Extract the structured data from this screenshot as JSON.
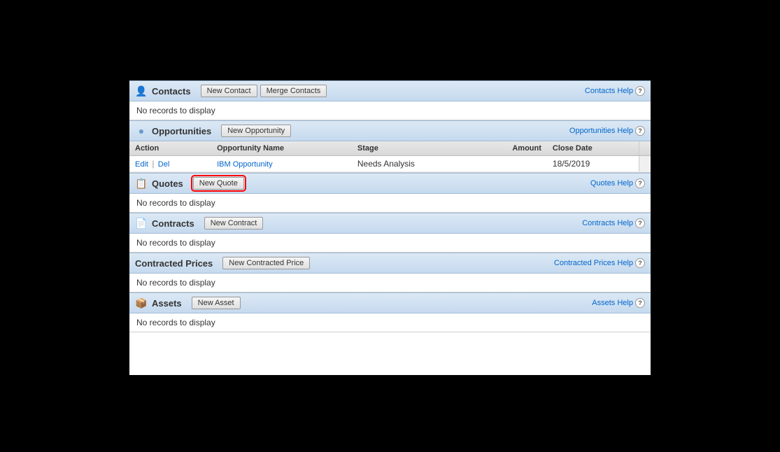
{
  "topBlackHeight": 115,
  "bottomBlackHeight": 110,
  "sections": {
    "contacts": {
      "title": "Contacts",
      "icon": "contacts-icon",
      "buttons": [
        {
          "label": "New Contact",
          "id": "new-contact",
          "highlighted": false
        },
        {
          "label": "Merge Contacts",
          "id": "merge-contacts",
          "highlighted": false
        }
      ],
      "helpText": "Contacts Help",
      "noRecords": "No records to display"
    },
    "opportunities": {
      "title": "Opportunities",
      "icon": "opportunities-icon",
      "buttons": [
        {
          "label": "New Opportunity",
          "id": "new-opportunity",
          "highlighted": false
        }
      ],
      "helpText": "Opportunities Help",
      "columns": [
        "Action",
        "Opportunity Name",
        "Stage",
        "Amount",
        "Close Date"
      ],
      "rows": [
        {
          "actions": [
            "Edit",
            "Del"
          ],
          "name": "IBM Opportunity",
          "stage": "Needs Analysis",
          "amount": "",
          "closeDate": "18/5/2019"
        }
      ]
    },
    "quotes": {
      "title": "Quotes",
      "icon": "quotes-icon",
      "buttons": [
        {
          "label": "New Quote",
          "id": "new-quote",
          "highlighted": true
        }
      ],
      "helpText": "Quotes Help",
      "noRecords": "No records to display"
    },
    "contracts": {
      "title": "Contracts",
      "icon": "contracts-icon",
      "buttons": [
        {
          "label": "New Contract",
          "id": "new-contract",
          "highlighted": false
        }
      ],
      "helpText": "Contracts Help",
      "noRecords": "No records to display"
    },
    "contractedPrices": {
      "title": "Contracted Prices",
      "icon": null,
      "buttons": [
        {
          "label": "New Contracted Price",
          "id": "new-contracted-price",
          "highlighted": false
        }
      ],
      "helpText": "Contracted Prices Help",
      "noRecords": "No records to display"
    },
    "assets": {
      "title": "Assets",
      "icon": "assets-icon",
      "buttons": [
        {
          "label": "New Asset",
          "id": "new-asset",
          "highlighted": false
        }
      ],
      "helpText": "Assets Help",
      "noRecords": "No records to display"
    }
  }
}
